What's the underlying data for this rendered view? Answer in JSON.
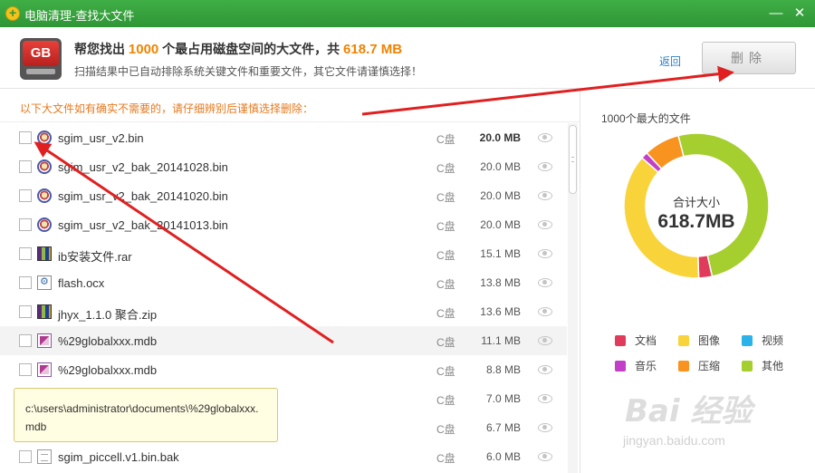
{
  "titlebar": {
    "title": "电脑清理-查找大文件",
    "minimize": "—",
    "close": "✕"
  },
  "header": {
    "headline_prefix": "帮您找出",
    "count": "1000",
    "headline_middle": "个最占用磁盘空间的大文件，共",
    "total": "618.7 MB",
    "subline": "扫描结果中已自动排除系统关键文件和重要文件，其它文件请谨慎选择！",
    "back": "返回",
    "delete": "删除",
    "icon_label": "GB"
  },
  "list": {
    "notice": "以下大文件如有确实不需要的，请仔细辨别后谨慎选择删除：",
    "rows": [
      {
        "icon": "bin-icon",
        "name": "sgim_usr_v2.bin",
        "drive": "C盘",
        "size": "20.0 MB",
        "bold": true
      },
      {
        "icon": "bin-icon",
        "name": "sgim_usr_v2_bak_20141028.bin",
        "drive": "C盘",
        "size": "20.0 MB"
      },
      {
        "icon": "bin-icon",
        "name": "sgim_usr_v2_bak_20141020.bin",
        "drive": "C盘",
        "size": "20.0 MB"
      },
      {
        "icon": "bin-icon",
        "name": "sgim_usr_v2_bak_20141013.bin",
        "drive": "C盘",
        "size": "20.0 MB"
      },
      {
        "icon": "rar-icon",
        "name": "ib安装文件.rar",
        "drive": "C盘",
        "size": "15.1 MB"
      },
      {
        "icon": "ocx-icon",
        "name": "flash.ocx",
        "drive": "C盘",
        "size": "13.8 MB"
      },
      {
        "icon": "rar-icon",
        "name": "jhyx_1.1.0 聚合.zip",
        "drive": "C盘",
        "size": "13.6 MB"
      },
      {
        "icon": "mdb-icon",
        "name": "%29globalxxx.mdb",
        "drive": "C盘",
        "size": "11.1 MB"
      },
      {
        "icon": "mdb-icon",
        "name": "%29globalxxx.mdb",
        "drive": "C盘",
        "size": "8.8 MB"
      },
      {
        "icon": "bin-icon",
        "name": "",
        "drive": "C盘",
        "size": "7.0 MB"
      },
      {
        "icon": "bin-icon",
        "name": "",
        "drive": "C盘",
        "size": "6.7 MB"
      },
      {
        "icon": "bak-icon",
        "name": "sgim_piccell.v1.bin.bak",
        "drive": "C盘",
        "size": "6.0 MB"
      }
    ]
  },
  "tooltip": {
    "text": "c:\\users\\administrator\\documents\\%29globalxxx.mdb"
  },
  "side": {
    "title": "1000个最大的文件",
    "center_label": "合计大小",
    "center_value": "618.7MB"
  },
  "chart_data": {
    "type": "pie",
    "categories": [
      "文档",
      "图像",
      "视频",
      "音乐",
      "压缩",
      "其他"
    ],
    "values": [
      3,
      37,
      0,
      1.5,
      8,
      50.5
    ],
    "colors": [
      "#e03b5a",
      "#f8d33a",
      "#29b3e8",
      "#c23fc7",
      "#f7931e",
      "#a5ce2f"
    ]
  },
  "watermark": {
    "logo": "Bai 经验",
    "sub": "jingyan.baidu.com"
  }
}
